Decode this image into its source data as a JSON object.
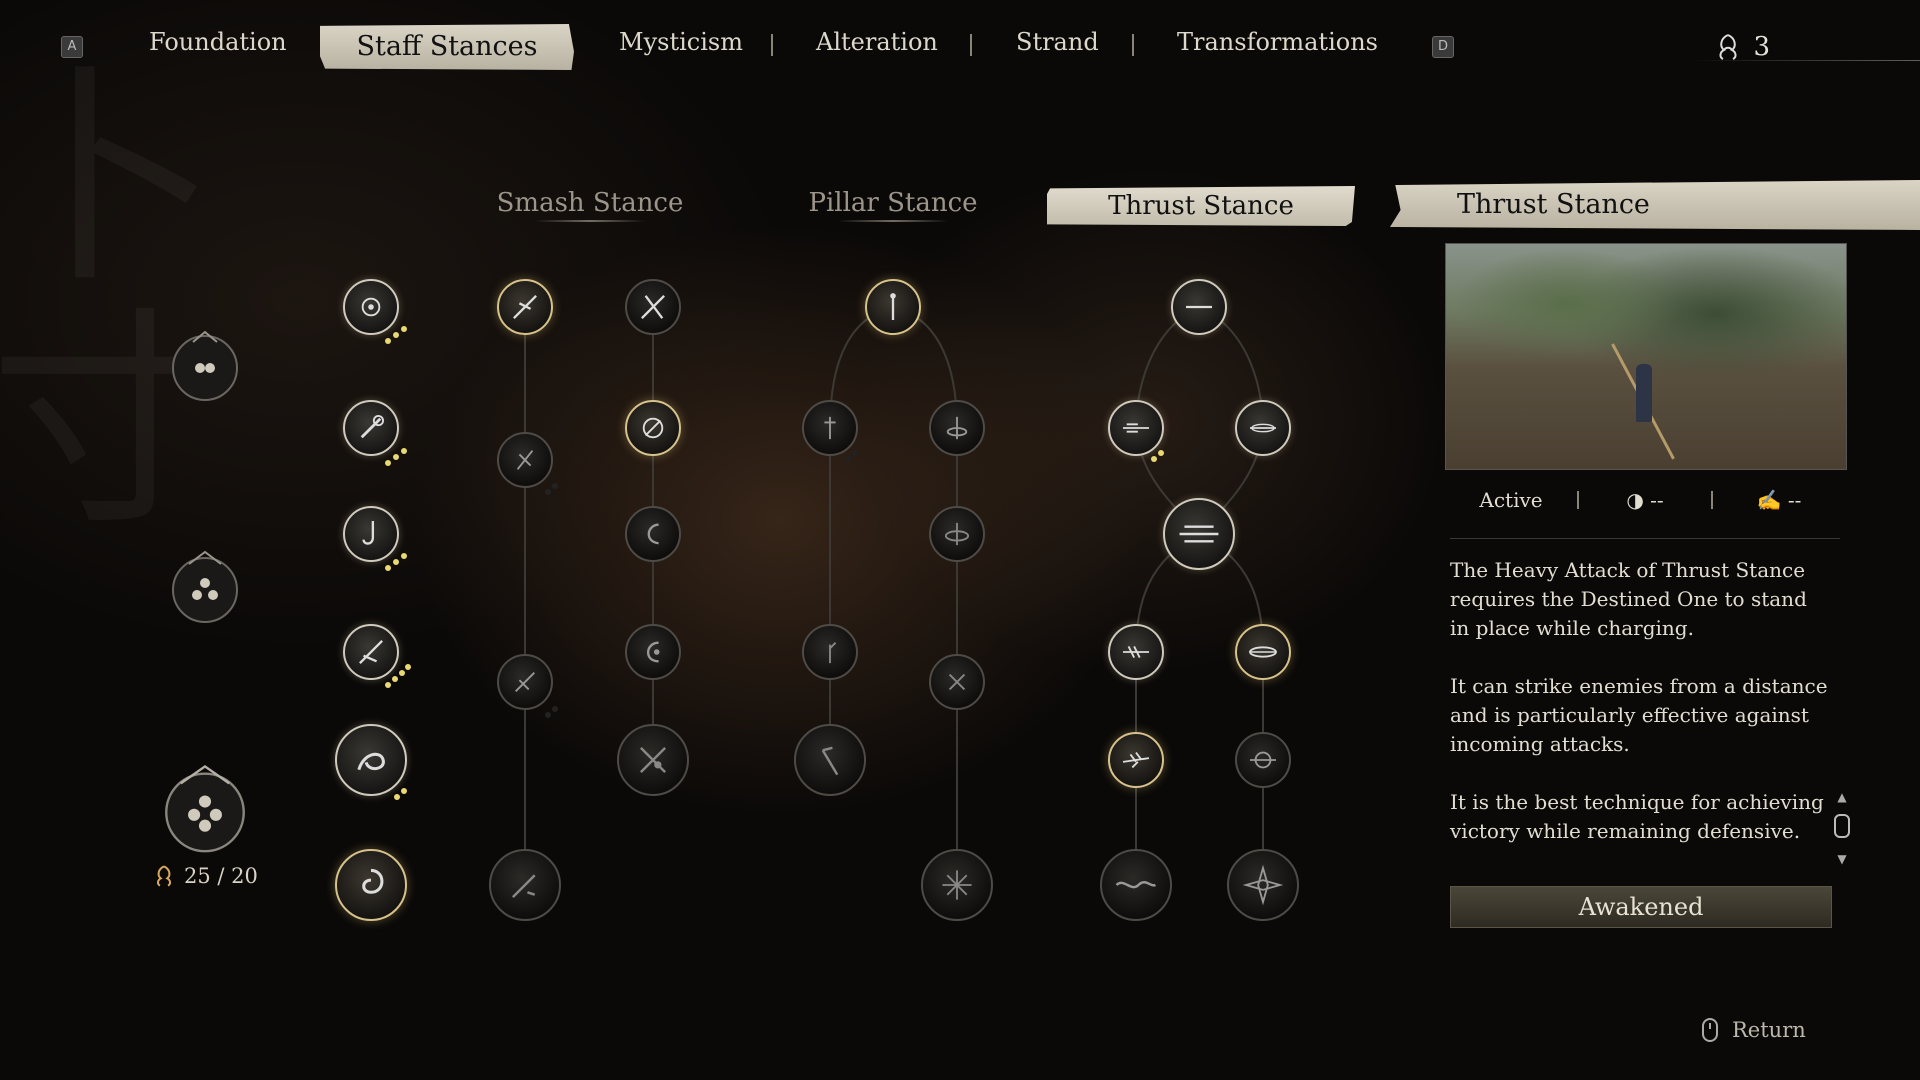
{
  "nav": {
    "left_key": "A",
    "right_key": "D",
    "tabs": [
      "Foundation",
      "Staff Stances",
      "Mysticism",
      "Alteration",
      "Strand",
      "Transformations"
    ],
    "active_tab": "Staff Stances",
    "sparks": "3"
  },
  "columns": {
    "smash": "Smash Stance",
    "pillar": "Pillar Stance",
    "thrust": "Thrust Stance"
  },
  "points": "25 / 20",
  "panel": {
    "title": "Thrust Stance",
    "type": "Active",
    "stat1": "--",
    "stat2": "--",
    "desc1": "The Heavy Attack of Thrust Stance requires the Destined One to stand in place while charging.",
    "desc2": "It can strike enemies from a distance and is particularly effective against incoming attacks.",
    "desc3": "It is the best technique for achieving victory while remaining defensive.",
    "status": "Awakened"
  },
  "footer": {
    "return": "Return"
  },
  "colors": {
    "accent_gold": "#e8d970",
    "panel_head": "#dad4c5"
  }
}
